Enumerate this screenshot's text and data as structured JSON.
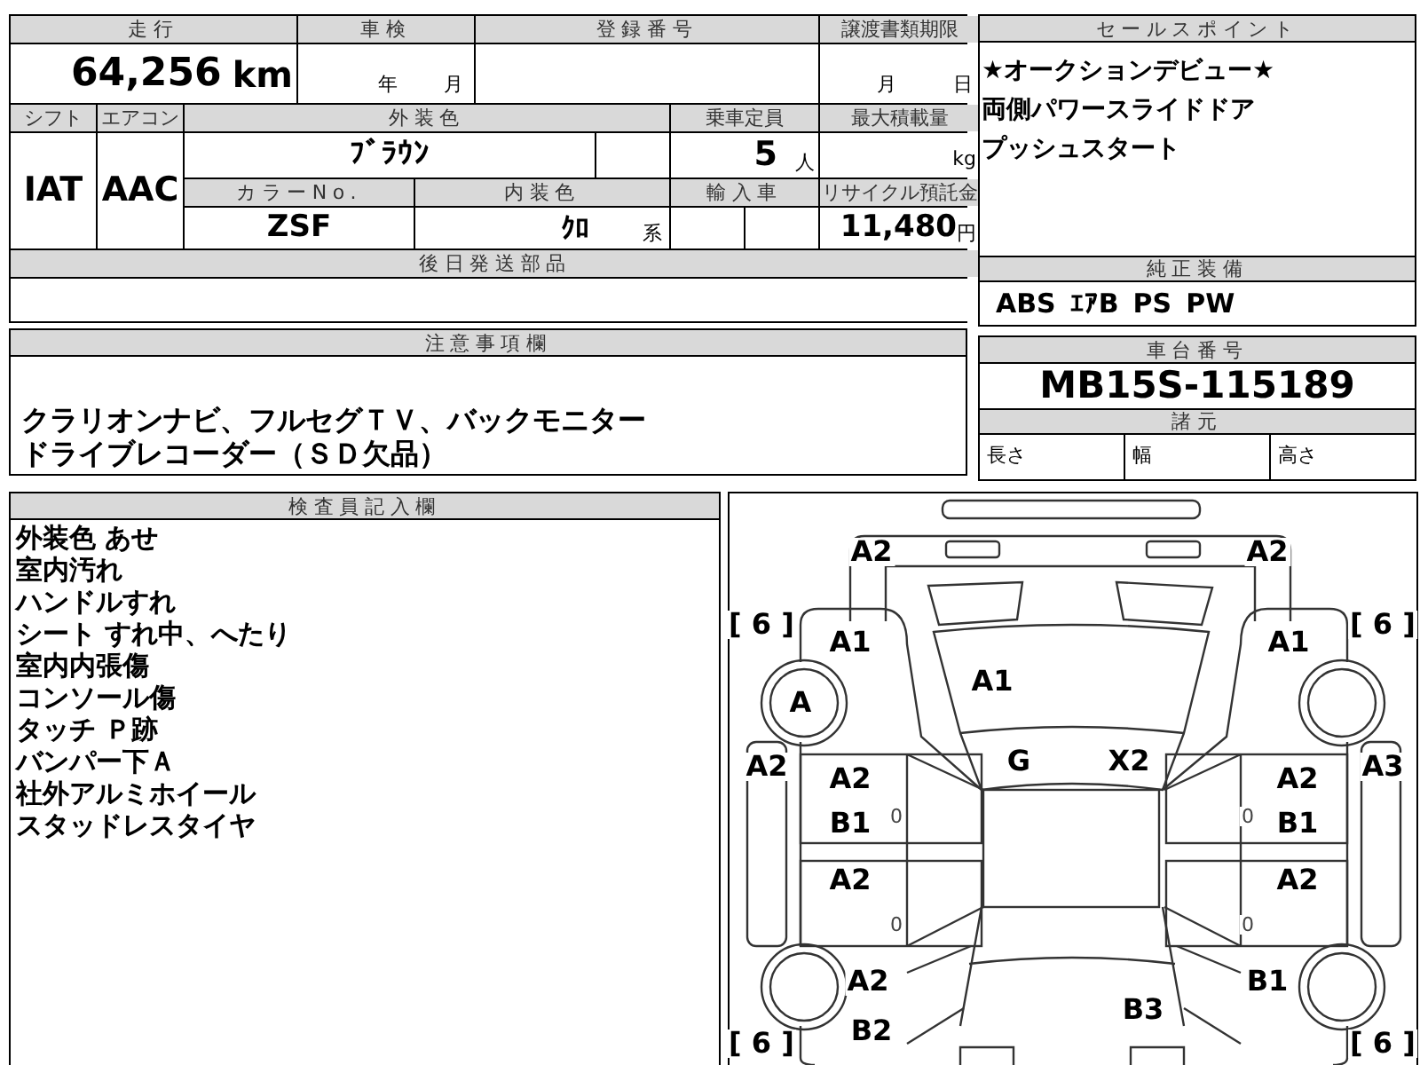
{
  "vehicle_table": {
    "mileage": {
      "label": "走行",
      "value": "64,256",
      "unit": "km"
    },
    "inspection": {
      "label": "車検",
      "year_unit": "年",
      "month_unit": "月"
    },
    "registration_number": {
      "label": "登録番号"
    },
    "transfer_deadline": {
      "label": "譲渡書類期限",
      "month_unit": "月",
      "day_unit": "日"
    },
    "shift": {
      "label": "シフト",
      "value": "IAT"
    },
    "air_conditioner": {
      "label": "エアコン",
      "value": "AAC"
    },
    "exterior_color": {
      "label": "外装色",
      "value": "ﾌﾞﾗｳﾝ"
    },
    "capacity": {
      "label": "乗車定員",
      "value": "5",
      "unit": "人"
    },
    "max_load": {
      "label": "最大積載量",
      "unit": "kg"
    },
    "color_number": {
      "label": "カラーNo.",
      "value": "ZSF"
    },
    "interior_color": {
      "label": "内装色",
      "value": "ｸﾛ",
      "suffix": "系"
    },
    "import": {
      "label": "輸入車"
    },
    "recycle_fee": {
      "label": "リサイクル預託金",
      "value": "11,480",
      "unit": "円"
    },
    "parts_to_ship": {
      "label": "後日発送部品"
    }
  },
  "sales_points": {
    "label": "セールスポイント",
    "lines": [
      "★オークションデビュー★",
      "両側パワースライドドア",
      "プッシュスタート"
    ]
  },
  "standard_equipment": {
    "label": "純正装備",
    "items": [
      "ABS",
      "ｴｱB",
      "PS",
      "PW"
    ]
  },
  "chassis": {
    "label": "車台番号",
    "value": "MB15S-115189"
  },
  "specs": {
    "label": "諸元",
    "fields": [
      "長さ",
      "幅",
      "高さ"
    ]
  },
  "notes": {
    "label": "注意事項欄",
    "lines": [
      "クラリオンナビ、フルセグＴＶ、バックモニター",
      "ドライブレコーダー（ＳＤ欠品）"
    ]
  },
  "inspector": {
    "label": "検査員記入欄",
    "lines": [
      "外装色 あせ",
      "室内汚れ",
      "ハンドルすれ",
      "シート すれ中、へたり",
      "室内内張傷",
      "コンソール傷",
      "タッチ Ｐ跡",
      "バンパー下Ａ",
      "社外アルミホイール",
      "スタッドレスタイヤ"
    ]
  },
  "diagram": {
    "marks": {
      "front_bumper_left": {
        "kind": "code",
        "text": "A2"
      },
      "front_bumper_right": {
        "kind": "code",
        "text": "A2"
      },
      "tread_front_left": {
        "kind": "tread",
        "text": "[ 6 ]"
      },
      "front_fender_left": {
        "kind": "code",
        "text": "A1"
      },
      "front_fender_right": {
        "kind": "code",
        "text": "A1"
      },
      "tread_front_right": {
        "kind": "tread",
        "text": "[ 6 ]"
      },
      "hood": {
        "kind": "code",
        "text": "A1"
      },
      "front_wheel_left": {
        "kind": "code",
        "text": "A"
      },
      "sill_left": {
        "kind": "code",
        "text": "A2"
      },
      "windshield_left": {
        "kind": "code",
        "text": "G"
      },
      "windshield_right": {
        "kind": "code",
        "text": "X2"
      },
      "front_door_left": {
        "kind": "code",
        "text": "A2"
      },
      "front_door_right": {
        "kind": "code",
        "text": "A2"
      },
      "sill_right": {
        "kind": "code",
        "text": "A3"
      },
      "front_door_left_lower": {
        "kind": "code",
        "text": "B1"
      },
      "front_door_left_minor": {
        "kind": "minor",
        "text": "0"
      },
      "front_door_right_minor": {
        "kind": "minor",
        "text": "0"
      },
      "front_door_right_lower": {
        "kind": "code",
        "text": "B1"
      },
      "rear_door_left": {
        "kind": "code",
        "text": "A2"
      },
      "rear_door_right": {
        "kind": "code",
        "text": "A2"
      },
      "rear_door_left_minor": {
        "kind": "minor",
        "text": "0"
      },
      "rear_door_right_minor": {
        "kind": "minor",
        "text": "0"
      },
      "rear_fender_left": {
        "kind": "code",
        "text": "A2"
      },
      "rear_fender_right": {
        "kind": "code",
        "text": "B1"
      },
      "trunk": {
        "kind": "code",
        "text": "B3"
      },
      "rear_quarter_left": {
        "kind": "code",
        "text": "B2"
      },
      "tread_rear_left": {
        "kind": "tread",
        "text": "[ 6 ]"
      },
      "tread_rear_right": {
        "kind": "tread",
        "text": "[ 6 ]"
      }
    }
  }
}
